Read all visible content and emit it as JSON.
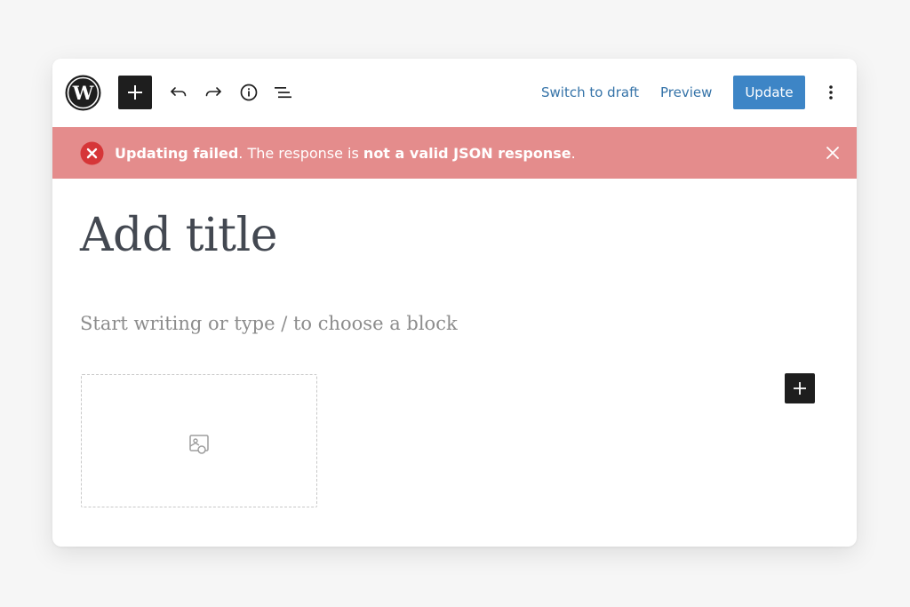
{
  "toolbar": {
    "switch_to_draft": "Switch to draft",
    "preview": "Preview",
    "update": "Update"
  },
  "notice": {
    "part1_bold": "Updating failed",
    "part2": ". The response is ",
    "part3_bold": "not a valid JSON response",
    "part4": "."
  },
  "editor": {
    "title_placeholder": "Add title",
    "body_placeholder": "Start writing or type / to choose a block"
  },
  "icons": {
    "logo": "wordpress-logo-icon",
    "inserter": "plus-icon",
    "undo": "undo-icon",
    "redo": "redo-icon",
    "info": "info-icon",
    "outline": "list-view-icon",
    "options": "more-vertical-icon",
    "error": "error-circle-icon",
    "close": "close-icon",
    "image": "image-icon"
  },
  "colors": {
    "accent": "#3d85c6",
    "link": "#3573a8",
    "notice_bg": "#e48c8c",
    "error_icon": "#d63638",
    "dark_button": "#1e1e1e"
  }
}
